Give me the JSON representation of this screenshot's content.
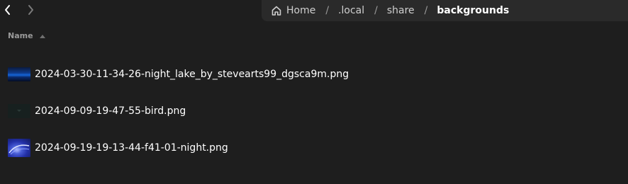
{
  "nav": {
    "back_icon": "chevron-left-icon",
    "forward_icon": "chevron-right-icon"
  },
  "pathbar": {
    "home_icon": "home-icon",
    "crumbs": [
      "Home",
      ".local",
      "share",
      "backgrounds"
    ],
    "separator": "/"
  },
  "list": {
    "column_name": "Name",
    "sort_icon": "sort-ascending-icon",
    "files": [
      {
        "name": "2024-03-30-11-34-26-night_lake_by_stevearts99_dgsca9m.png"
      },
      {
        "name": "2024-09-09-19-47-55-bird.png"
      },
      {
        "name": "2024-09-19-19-13-44-f41-01-night.png"
      }
    ]
  },
  "colors": {
    "background": "#1e1e1e",
    "pathbar_bg": "#2a2a2a",
    "text": "#ffffff",
    "muted_text": "#9a9a9a"
  }
}
